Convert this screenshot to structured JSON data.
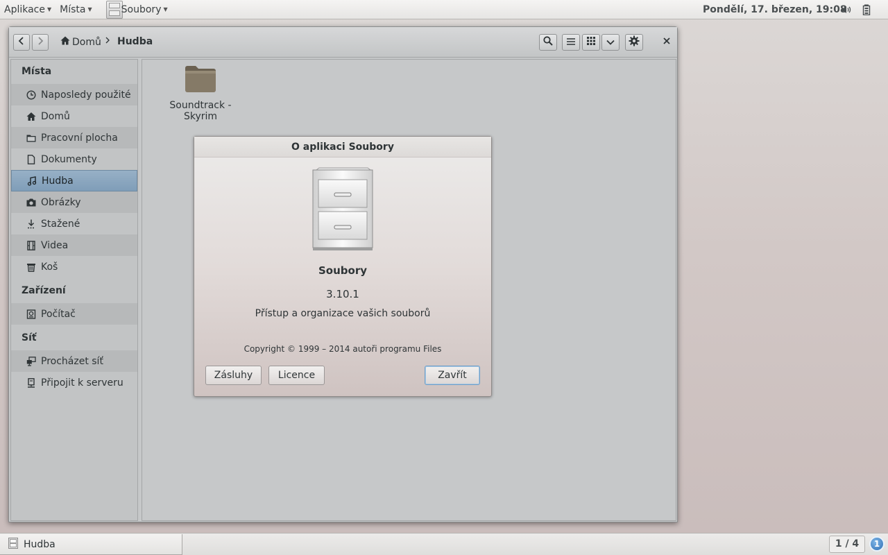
{
  "top_panel": {
    "applications_label": "Aplikace",
    "places_label": "Místa",
    "app_menu_label": "Soubory",
    "clock": "Pondělí, 17. březen, 19:08"
  },
  "toolbar": {
    "breadcrumb_home": "Domů",
    "breadcrumb_current": "Hudba"
  },
  "sidebar": {
    "heading_places": "Místa",
    "heading_devices": "Zařízení",
    "heading_network": "Síť",
    "items": [
      {
        "label": "Naposledy použité",
        "icon": "clock-icon"
      },
      {
        "label": "Domů",
        "icon": "home-icon"
      },
      {
        "label": "Pracovní plocha",
        "icon": "folder-icon"
      },
      {
        "label": "Dokumenty",
        "icon": "document-icon"
      },
      {
        "label": "Hudba",
        "icon": "music-icon",
        "selected": true
      },
      {
        "label": "Obrázky",
        "icon": "camera-icon"
      },
      {
        "label": "Stažené",
        "icon": "download-icon"
      },
      {
        "label": "Videa",
        "icon": "film-icon"
      },
      {
        "label": "Koš",
        "icon": "trash-icon"
      }
    ],
    "devices": [
      {
        "label": "Počítač",
        "icon": "computer-icon"
      }
    ],
    "network": [
      {
        "label": "Procházet síť",
        "icon": "network-icon"
      },
      {
        "label": "Připojit k serveru",
        "icon": "server-icon"
      }
    ]
  },
  "content": {
    "folders": [
      {
        "label": "Soundtrack - Skyrim"
      }
    ]
  },
  "about_dialog": {
    "title": "O aplikaci Soubory",
    "app_name": "Soubory",
    "version": "3.10.1",
    "description": "Přístup a organizace vašich souborů",
    "copyright": "Copyright © 1999 – 2014 autoři programu Files",
    "credits_button": "Zásluhy",
    "license_button": "Licence",
    "close_button": "Zavřít"
  },
  "bottom_bar": {
    "task_label": "Hudba",
    "workspace": "1 / 4",
    "notification_count": "1"
  },
  "colors": {
    "selection": "#8aa6bf",
    "focus_ring": "#6f9fc8",
    "notification": "#2e6fb3"
  }
}
